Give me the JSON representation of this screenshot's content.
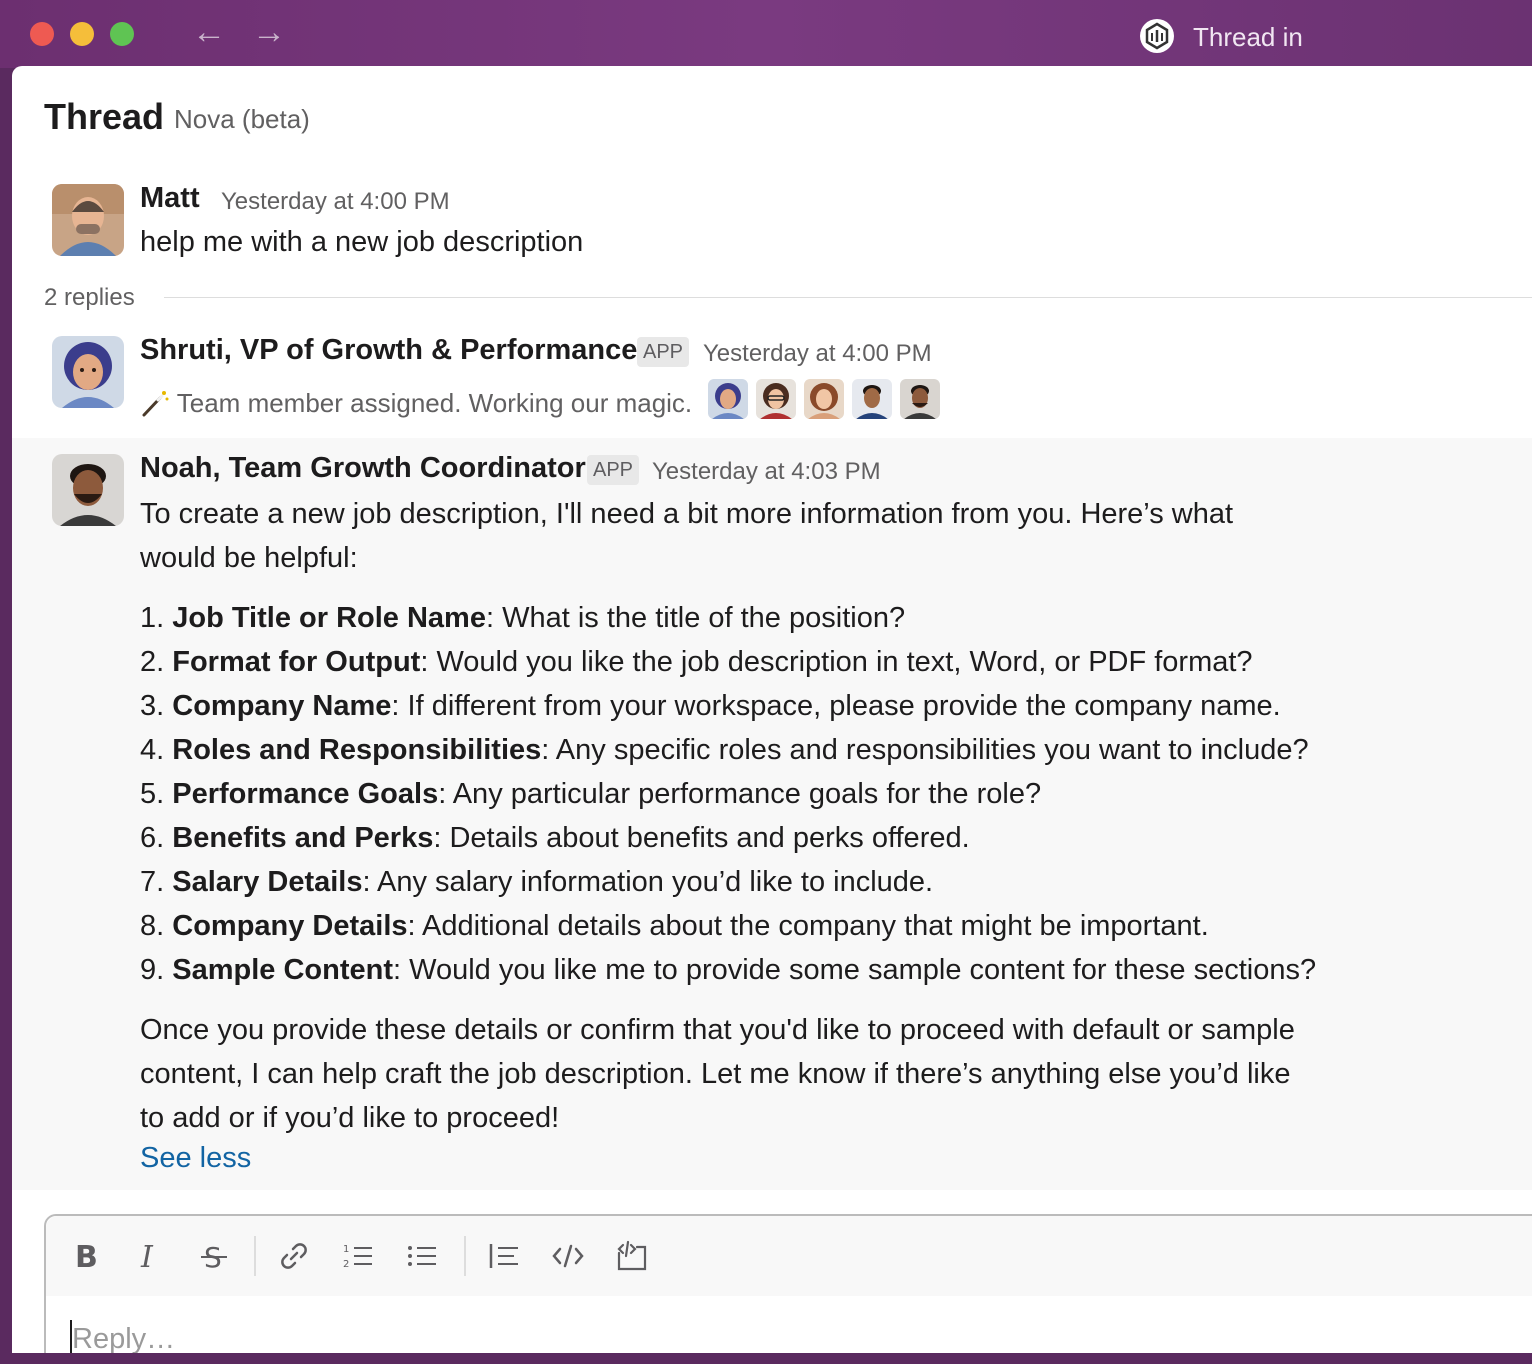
{
  "window": {
    "title": "Thread in"
  },
  "thread": {
    "title": "Thread",
    "subtitle": "Nova (beta)"
  },
  "root_message": {
    "author": "Matt",
    "time": "Yesterday at 4:00 PM",
    "text": "help me with a new job description"
  },
  "replies": {
    "count_label": "2 replies"
  },
  "reply1": {
    "author": "Shruti, VP of Growth & Performance",
    "badge": "APP",
    "time": "Yesterday at 4:00 PM",
    "status_icon": "magic-wand-icon",
    "text": "Team member assigned. Working our magic."
  },
  "reply2": {
    "author": "Noah, Team Growth Coordinator",
    "badge": "APP",
    "time": "Yesterday at 4:03 PM",
    "intro_line1": "To create a new job description, I'll need a bit more information from you. Here’s what",
    "intro_line2": "would be helpful:",
    "items": [
      {
        "num": "1. ",
        "bold": "Job Title or Role Name",
        "rest": ": What is the title of the position?"
      },
      {
        "num": "2. ",
        "bold": "Format for Output",
        "rest": ": Would you like the job description in text, Word, or PDF format?"
      },
      {
        "num": "3. ",
        "bold": "Company Name",
        "rest": ": If different from your workspace, please provide the company name."
      },
      {
        "num": "4. ",
        "bold": "Roles and Responsibilities",
        "rest": ": Any specific roles and responsibilities you want to include?"
      },
      {
        "num": "5. ",
        "bold": "Performance Goals",
        "rest": ": Any particular performance goals for the role?"
      },
      {
        "num": "6. ",
        "bold": "Benefits and Perks",
        "rest": ": Details about benefits and perks offered."
      },
      {
        "num": "7. ",
        "bold": "Salary Details",
        "rest": ": Any salary information you’d like to include."
      },
      {
        "num": "8. ",
        "bold": "Company Details",
        "rest": ": Additional details about the company that might be important."
      },
      {
        "num": "9. ",
        "bold": "Sample Content",
        "rest": ": Would you like me to provide some sample content for these sections?"
      }
    ],
    "outro_line1": "Once you provide these details or confirm that you'd like to proceed with default or sample",
    "outro_line2": "content, I can help craft the job description. Let me know if there’s anything else you’d like",
    "outro_line3": "to add or if you’d like to proceed!",
    "see_less": "See less"
  },
  "composer": {
    "placeholder": "Reply…",
    "value": "",
    "toolbar": [
      "bold-icon",
      "italic-icon",
      "strikethrough-icon",
      "link-icon",
      "ordered-list-icon",
      "bulleted-list-icon",
      "blockquote-icon",
      "code-icon",
      "code-block-icon"
    ]
  },
  "colors": {
    "titlebar": "#6c2f70",
    "link": "#1264a3",
    "text": "#1d1c1d",
    "muted": "#616061"
  }
}
